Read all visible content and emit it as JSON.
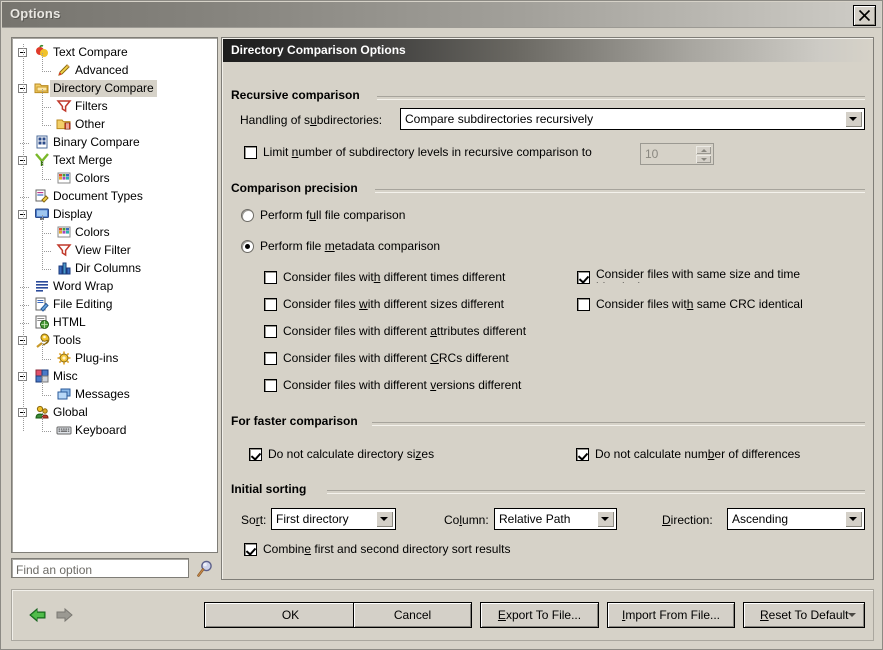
{
  "window": {
    "title": "Options",
    "close_icon": "close-icon"
  },
  "sidebar": {
    "search": {
      "placeholder": "Find an option",
      "value": "",
      "icon": "search-icon"
    },
    "items": [
      {
        "label": "Text Compare",
        "depth": 0,
        "icon": "text-compare-icon",
        "expander": "minus",
        "selected": false
      },
      {
        "label": "Advanced",
        "depth": 1,
        "icon": "advanced-icon",
        "expander": "none",
        "selected": false
      },
      {
        "label": "Directory Compare",
        "depth": 0,
        "icon": "directory-compare-icon",
        "expander": "minus",
        "selected": true
      },
      {
        "label": "Filters",
        "depth": 1,
        "icon": "filter-icon",
        "expander": "none",
        "selected": false
      },
      {
        "label": "Other",
        "depth": 1,
        "icon": "folder-other-icon",
        "expander": "none",
        "selected": false
      },
      {
        "label": "Binary Compare",
        "depth": 0,
        "icon": "binary-compare-icon",
        "expander": "none",
        "selected": false
      },
      {
        "label": "Text Merge",
        "depth": 0,
        "icon": "text-merge-icon",
        "expander": "minus",
        "selected": false
      },
      {
        "label": "Colors",
        "depth": 1,
        "icon": "colors-icon",
        "expander": "none",
        "selected": false
      },
      {
        "label": "Document Types",
        "depth": 0,
        "icon": "document-types-icon",
        "expander": "none",
        "selected": false
      },
      {
        "label": "Display",
        "depth": 0,
        "icon": "display-icon",
        "expander": "minus",
        "selected": false
      },
      {
        "label": "Colors",
        "depth": 1,
        "icon": "colors-icon",
        "expander": "none",
        "selected": false
      },
      {
        "label": "View Filter",
        "depth": 1,
        "icon": "filter-icon",
        "expander": "none",
        "selected": false
      },
      {
        "label": "Dir Columns",
        "depth": 1,
        "icon": "dir-columns-icon",
        "expander": "none",
        "selected": false
      },
      {
        "label": "Word Wrap",
        "depth": 0,
        "icon": "word-wrap-icon",
        "expander": "none",
        "selected": false
      },
      {
        "label": "File Editing",
        "depth": 0,
        "icon": "file-editing-icon",
        "expander": "none",
        "selected": false
      },
      {
        "label": "HTML",
        "depth": 0,
        "icon": "html-icon",
        "expander": "none",
        "selected": false
      },
      {
        "label": "Tools",
        "depth": 0,
        "icon": "tools-icon",
        "expander": "minus",
        "selected": false
      },
      {
        "label": "Plug-ins",
        "depth": 1,
        "icon": "plugins-icon",
        "expander": "none",
        "selected": false
      },
      {
        "label": "Misc",
        "depth": 0,
        "icon": "misc-icon",
        "expander": "minus",
        "selected": false
      },
      {
        "label": "Messages",
        "depth": 1,
        "icon": "messages-icon",
        "expander": "none",
        "selected": false
      },
      {
        "label": "Global",
        "depth": 0,
        "icon": "global-icon",
        "expander": "minus",
        "selected": false
      },
      {
        "label": "Keyboard",
        "depth": 1,
        "icon": "keyboard-icon",
        "expander": "none",
        "selected": false
      }
    ]
  },
  "pane": {
    "header": "Directory Comparison Options",
    "recursive": {
      "title": "Recursive comparison",
      "handling_label": "Handling of s<u>u</u>bdirectories:",
      "handling_value": "Compare subdirectories recursively",
      "limit_label": "Limit <u>n</u>umber of subdirectory levels in recursive comparison to",
      "limit_checked": false,
      "limit_value": "10",
      "limit_enabled": false
    },
    "precision": {
      "title": "Comparison precision",
      "radio_full": "Perform f<u>u</u>ll file comparison",
      "radio_full_selected": false,
      "radio_meta": "Perform file <u>m</u>etadata comparison",
      "radio_meta_selected": true,
      "left_checks": [
        {
          "label": "Consider files wit<u>h</u> different times different",
          "checked": false
        },
        {
          "label": "Consider files <u>w</u>ith different sizes different",
          "checked": false
        },
        {
          "label": "Consider files with different <u>a</u>ttributes different",
          "checked": false
        },
        {
          "label": "Consider files with different <u>C</u>RCs different",
          "checked": false
        },
        {
          "label": "Consider files with different <u>v</u>ersions different",
          "checked": false
        }
      ],
      "right_checks": [
        {
          "label": "Consider files with same size and time identical",
          "checked": true,
          "clipped": true
        },
        {
          "label": "Consider files wit<u>h</u> same CRC identical",
          "checked": false,
          "clipped": false
        }
      ]
    },
    "faster": {
      "title": "For faster comparison",
      "checks": [
        {
          "label": "Do not calculate directory si<u>z</u>es",
          "checked": true
        },
        {
          "label": "Do not calculate num<u>b</u>er of differences",
          "checked": true
        }
      ]
    },
    "sorting": {
      "title": "Initial sorting",
      "sort_label": "So<u>r</u>t:",
      "sort_value": "First directory",
      "column_label": "Co<u>l</u>umn:",
      "column_value": "Relative Path",
      "direction_label": "<u>D</u>irection:",
      "direction_value": "Ascending",
      "combine_label": "Combin<u>e</u> first and second directory sort results",
      "combine_checked": true
    }
  },
  "footer": {
    "back_icon": "back-arrow-icon",
    "forward_icon": "forward-arrow-icon",
    "buttons": [
      {
        "label": "OK",
        "name": "ok-button"
      },
      {
        "label": "Cancel",
        "name": "cancel-button"
      },
      {
        "label": "<u>E</u>xport To File...",
        "name": "export-to-file-button"
      },
      {
        "label": "<u>I</u>mport From File...",
        "name": "import-from-file-button"
      },
      {
        "label": "<u>R</u>eset To Default",
        "name": "reset-to-default-button"
      }
    ]
  },
  "colors": {
    "dialog_face": "#d6d2c8",
    "header_dark": "#1c1c1c",
    "selection": "#d6d2c8",
    "enabled_arrow": "#2f9e2f",
    "disabled_arrow": "#8a8880"
  }
}
